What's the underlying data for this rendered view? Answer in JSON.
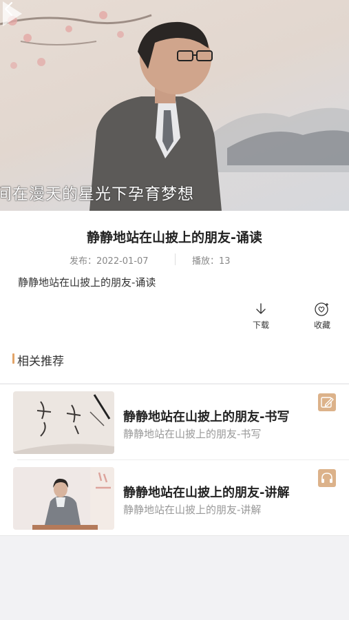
{
  "video": {
    "subtitle_text": "间在漫天的星光下孕育梦想"
  },
  "content": {
    "title": "静静地站在山披上的朋友-诵读",
    "publish_label": "发布：",
    "publish_date": "2022-01-07",
    "plays_label": "播放：",
    "plays_count": "13",
    "description": "静静地站在山披上的朋友-诵读"
  },
  "actions": {
    "download_label": "下载",
    "favorite_label": "收藏"
  },
  "related": {
    "section_title": "相关推荐",
    "items": [
      {
        "title": "静静地站在山披上的朋友-书写",
        "subtitle": "静静地站在山披上的朋友-书写",
        "badge_icon": "edit-icon"
      },
      {
        "title": "静静地站在山披上的朋友-讲解",
        "subtitle": "静静地站在山披上的朋友-讲解",
        "badge_icon": "headphones-icon"
      }
    ]
  },
  "colors": {
    "accent": "#e2a469",
    "badge": "#dcb28a",
    "background": "#f2f2f4"
  }
}
